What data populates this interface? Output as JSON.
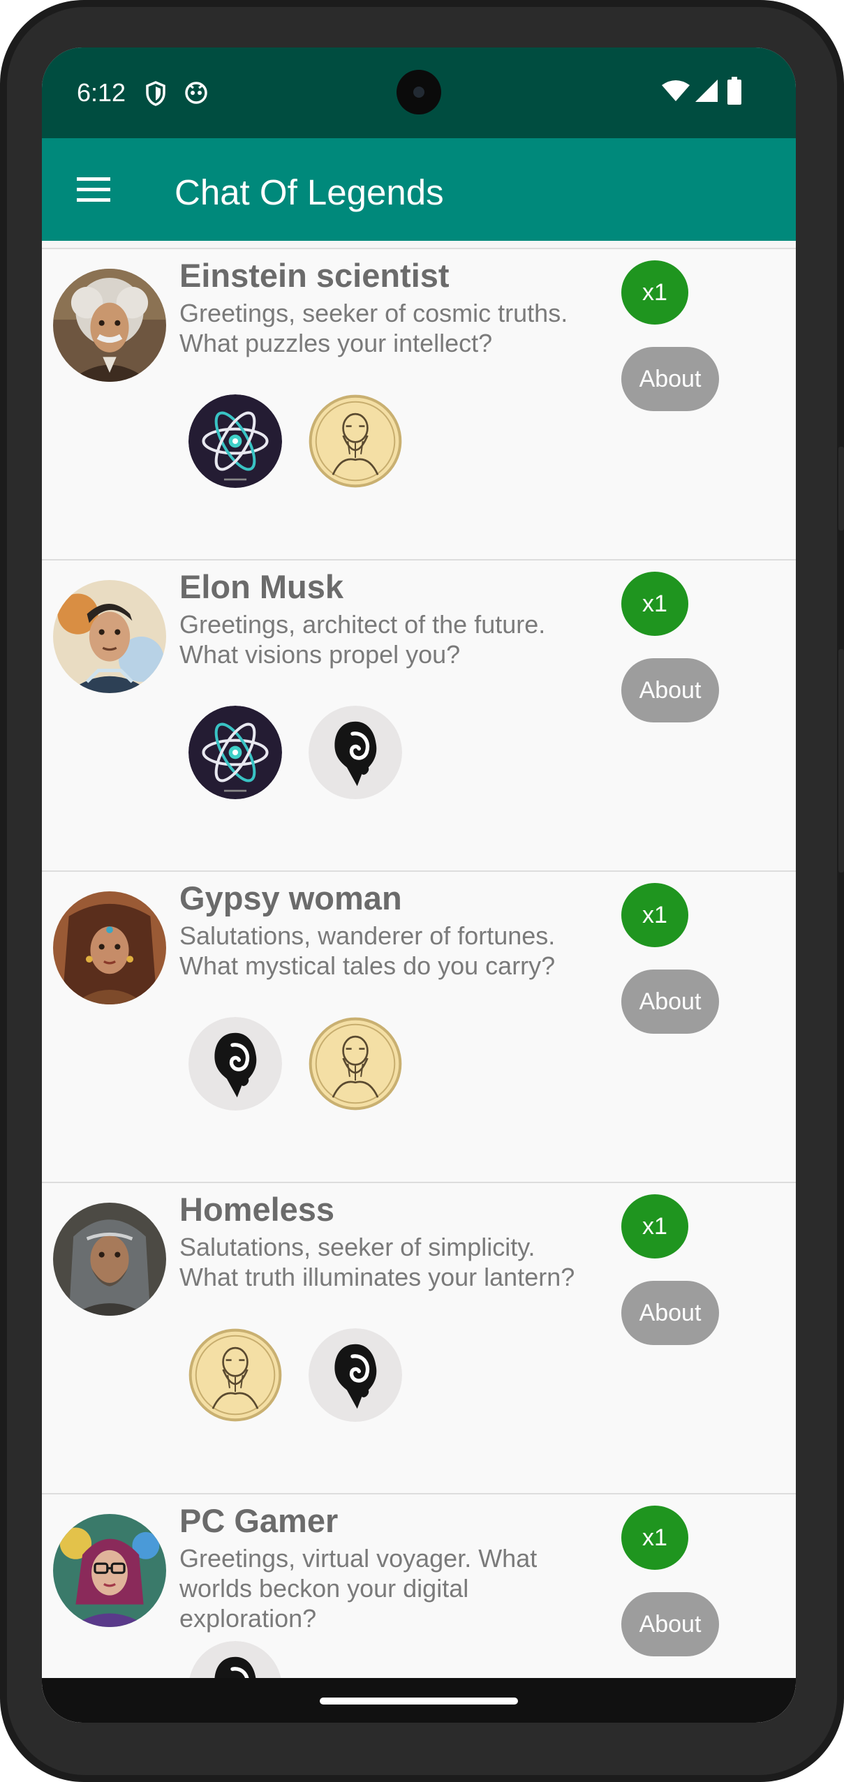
{
  "status": {
    "time": "6:12"
  },
  "appbar": {
    "title": "Chat Of Legends"
  },
  "characters": [
    {
      "name": "Einstein scientist",
      "greeting": "Greetings, seeker of cosmic truths. What puzzles your intellect?",
      "count_label": "x1",
      "about_label": "About"
    },
    {
      "name": "Elon Musk",
      "greeting": "Greetings, architect of the future. What visions propel you?",
      "count_label": "x1",
      "about_label": "About"
    },
    {
      "name": "Gypsy woman",
      "greeting": "Salutations, wanderer of fortunes. What mystical tales do you carry?",
      "count_label": "x1",
      "about_label": "About"
    },
    {
      "name": "Homeless",
      "greeting": "Salutations, seeker of simplicity. What truth illuminates your lantern?",
      "count_label": "x1",
      "about_label": "About"
    },
    {
      "name": "PC Gamer",
      "greeting": "Greetings, virtual voyager. What worlds beckon your digital exploration?",
      "count_label": "x1",
      "about_label": "About"
    }
  ],
  "colors": {
    "status_bar": "#004d40",
    "app_bar": "#00897b",
    "count_button": "#1f951f",
    "about_button": "#9d9d9d"
  }
}
